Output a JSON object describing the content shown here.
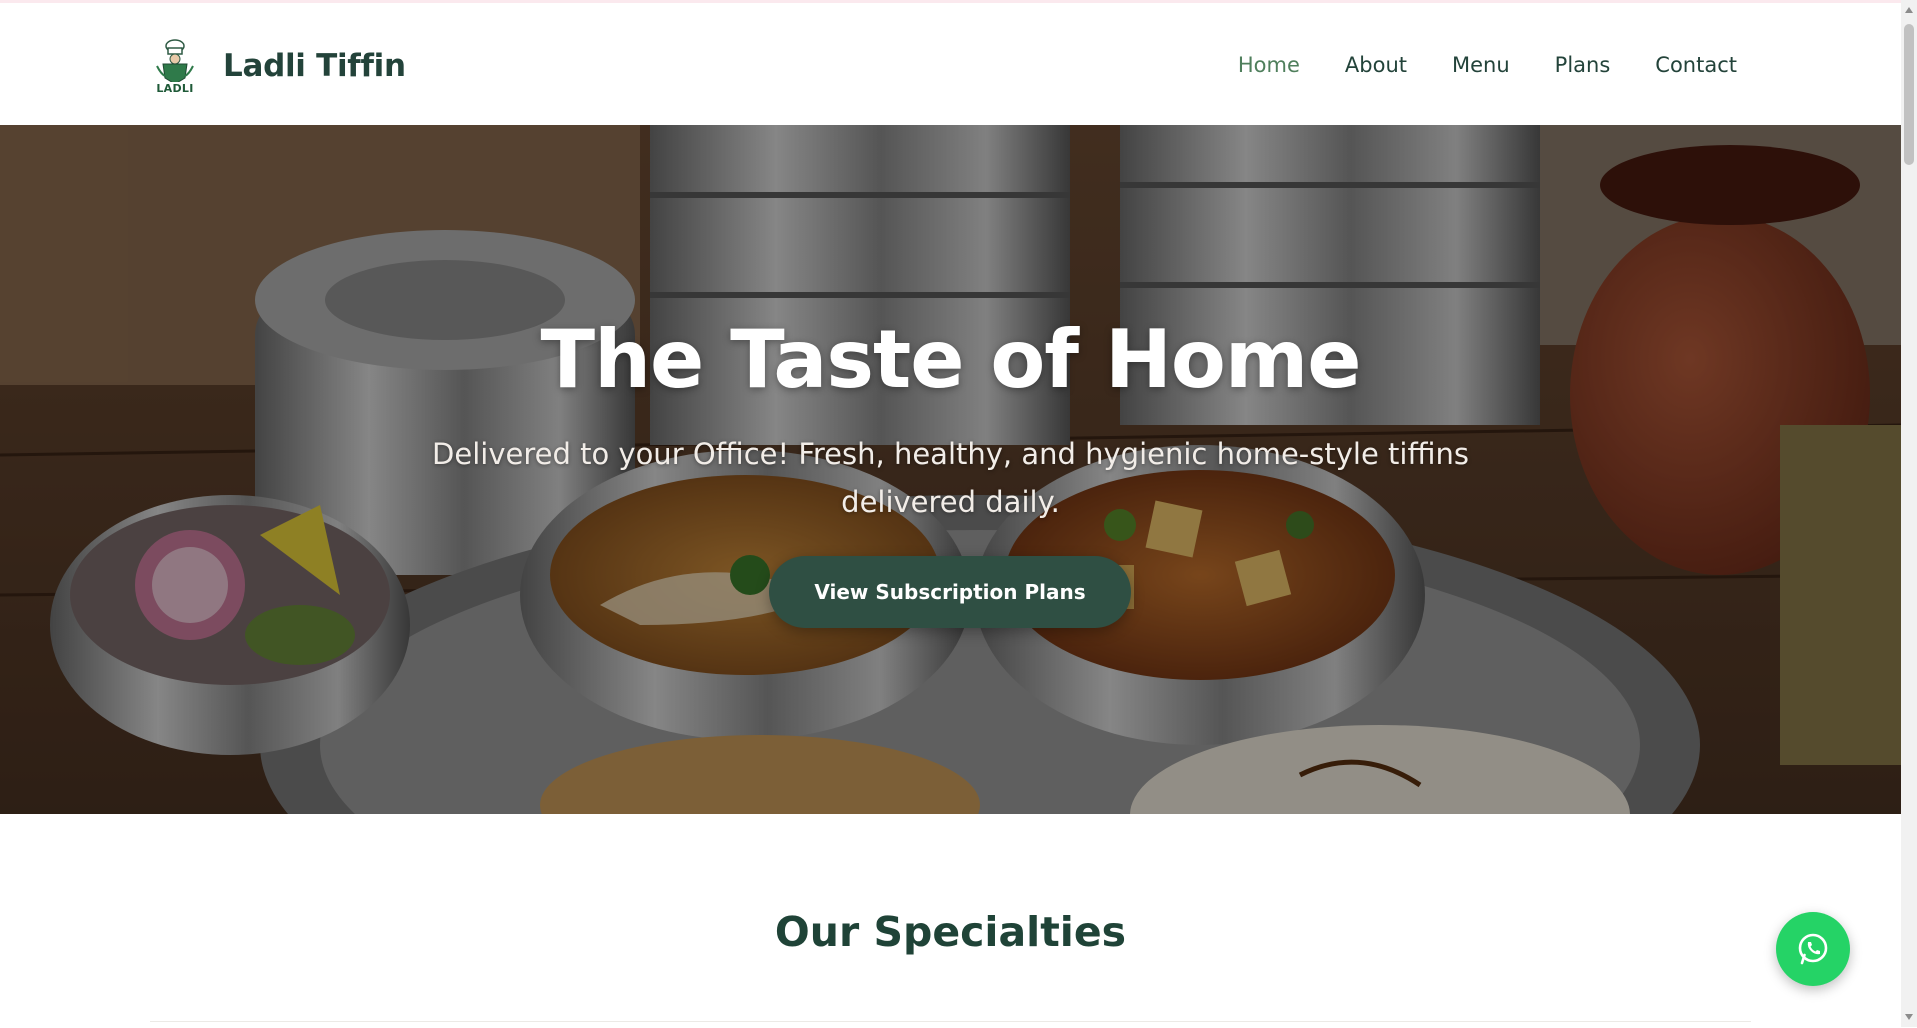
{
  "brand": {
    "name": "Ladli Tiffin",
    "logo_text": "LADLI"
  },
  "nav": {
    "items": [
      {
        "label": "Home",
        "active": true
      },
      {
        "label": "About",
        "active": false
      },
      {
        "label": "Menu",
        "active": false
      },
      {
        "label": "Plans",
        "active": false
      },
      {
        "label": "Contact",
        "active": false
      }
    ]
  },
  "hero": {
    "title": "The Taste of Home",
    "subtitle": "Delivered to your Office! Fresh, healthy, and hygienic home-style tiffins delivered daily.",
    "cta_label": "View Subscription Plans"
  },
  "specialties": {
    "title": "Our Specialties"
  },
  "icons": {
    "logo": "chef-crest-icon",
    "whatsapp": "whatsapp-icon"
  },
  "colors": {
    "brand_green": "#23433a",
    "active_nav": "#4f7f5c",
    "cta_bg": "#2f4f43",
    "whatsapp": "#25d366"
  }
}
